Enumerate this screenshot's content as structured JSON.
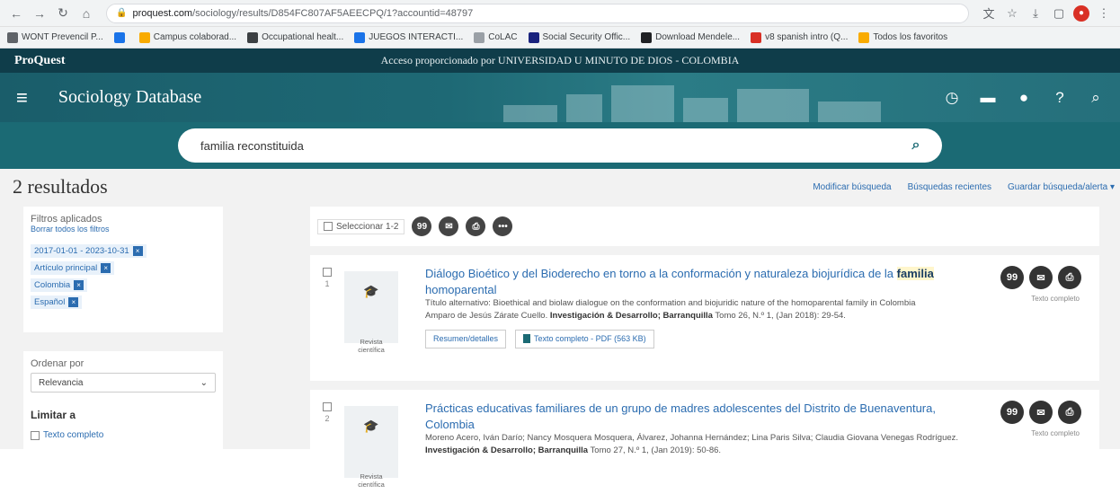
{
  "browser": {
    "url_host": "proquest.com",
    "url_path": "/sociology/results/D854FC807AF5AEECPQ/1?accountid=48797",
    "bookmarks": [
      {
        "label": "WONT Prevencil P...",
        "color": "#5f6368"
      },
      {
        "label": "",
        "color": "#1a73e8"
      },
      {
        "label": "Campus colaborad...",
        "color": "#f9ab00"
      },
      {
        "label": "Occupational healt...",
        "color": "#3c4043"
      },
      {
        "label": "JUEGOS INTERACTI...",
        "color": "#1a73e8"
      },
      {
        "label": "CoLAC",
        "color": "#9aa0a6"
      },
      {
        "label": "Social Security Offic...",
        "color": "#1a237e"
      },
      {
        "label": "Download Mendele...",
        "color": "#202124"
      },
      {
        "label": "v8 spanish intro (Q...",
        "color": "#d93025"
      },
      {
        "label": "Todos los favoritos",
        "color": "#f9ab00"
      }
    ]
  },
  "header": {
    "logo": "ProQuest",
    "access": "Acceso proporcionado por UNIVERSIDAD U MINUTO DE DIOS - COLOMBIA",
    "db_title": "Sociology Database"
  },
  "search": {
    "query": "familia reconstituida"
  },
  "results": {
    "count_label": "2 resultados",
    "links": [
      "Modificar búsqueda",
      "Búsquedas recientes",
      "Guardar búsqueda/alerta ▾"
    ],
    "select_label": "Seleccionar 1-2",
    "items": [
      {
        "index": "1",
        "title_pre": "Diálogo Bioético y del Bioderecho en torno a la conformación y naturaleza biojurídica de la ",
        "title_hl": "familia",
        "title_post": " homoparental",
        "alt_title": "Título alternativo: Bioethical and biolaw dialogue on the conformation and biojuridic nature of the homoparental family in Colombia",
        "authors": "Amparo de Jesús Zárate Cuello. ",
        "source": "Investigación & Desarrollo; Barranquilla",
        "source_tail": " Tomo 26, N.º 1,  (Jan 2018): 29-54.",
        "type": "Revista científica",
        "btn1": "Resumen/detalles",
        "btn2": "Texto completo - PDF (563 KB)",
        "fulltext": "Texto completo"
      },
      {
        "index": "2",
        "title_pre": "Prácticas educativas familiares de un grupo de madres adolescentes del Distrito de Buenaventura, Colombia",
        "title_hl": "",
        "title_post": "",
        "alt_title": "Moreno Acero, Iván Darío; Nancy Mosquera Mosquera, Álvarez, Johanna Hernández; Lina Paris Silva; Claudia Giovana Venegas Rodríguez. ",
        "authors": "",
        "source": "Investigación & Desarrollo; Barranquilla",
        "source_tail": " Tomo 27, N.º 1,  (Jan 2019): 50-86.",
        "type": "Revista científica",
        "btn1": "",
        "btn2": "",
        "fulltext": "Texto completo"
      }
    ]
  },
  "sidebar": {
    "filters_title": "Filtros aplicados",
    "clear_all": "Borrar todos los filtros",
    "chips": [
      "2017-01-01 - 2023-10-31",
      "Artículo principal",
      "Colombia",
      "Español"
    ],
    "sort_label": "Ordenar por",
    "sort_value": "Relevancia",
    "limit_title": "Limitar a",
    "limit_items": [
      "Texto completo"
    ]
  },
  "colors": {
    "brand_dark": "#0f3d4a",
    "brand_teal": "#1b6a74",
    "link_blue": "#2b6cb0"
  }
}
